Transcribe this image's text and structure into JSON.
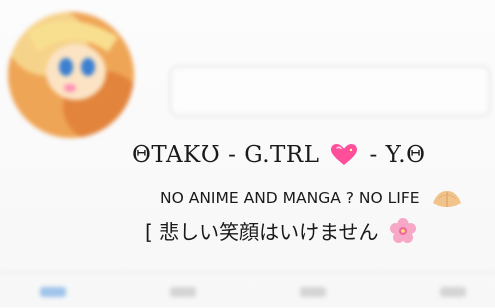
{
  "profile": {
    "display_name_left": "ΘTAKƱ - G.TRL",
    "display_name_right": "- Y.Θ",
    "tagline": "NO ANIME AND MANGA ? NO LIFE",
    "japanese_line": "[ 悲しい笑顔はいけません",
    "heart_icon": "sparkling-heart",
    "hands_icon": "palms-together",
    "flower_icon": "cherry-blossom"
  },
  "colors": {
    "heart": "#ff4f9a",
    "blossom": "#f7a8c7",
    "tab_active": "#9fc3ea",
    "avatar_base": "#f0a95a"
  }
}
